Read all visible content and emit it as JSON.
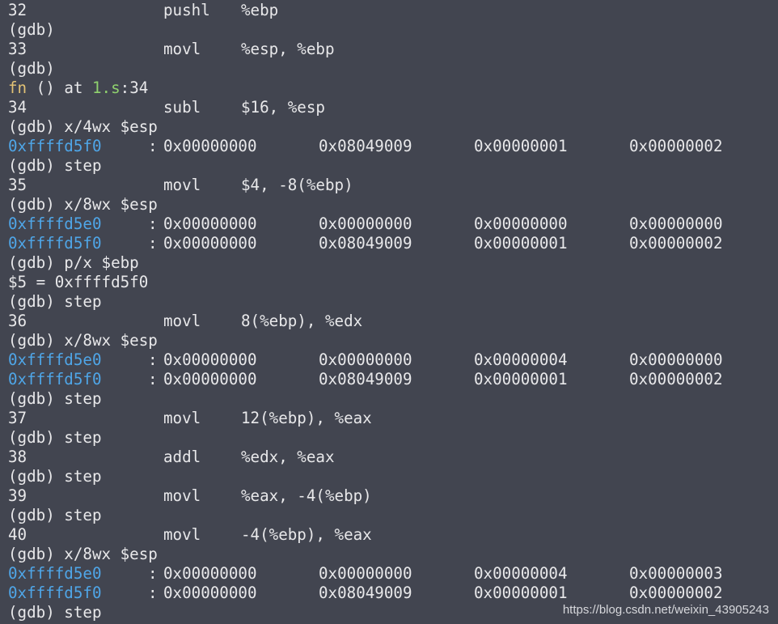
{
  "colors": {
    "background": "#424550",
    "text": "#e8e8ea",
    "address": "#4fa6e8",
    "function_name": "#e2c275",
    "file_name": "#8fd16e"
  },
  "lines": [
    {
      "kind": "src",
      "num": "32",
      "op": "pushl",
      "args": "%ebp"
    },
    {
      "kind": "text",
      "text": "(gdb)"
    },
    {
      "kind": "src",
      "num": "33",
      "op": "movl",
      "args": "%esp, %ebp"
    },
    {
      "kind": "text",
      "text": "(gdb)"
    },
    {
      "kind": "frame",
      "fn": "fn",
      "mid": " () at ",
      "file": "1.s",
      "tail": ":34"
    },
    {
      "kind": "src",
      "num": "34",
      "op": "subl",
      "args": "$16, %esp"
    },
    {
      "kind": "text",
      "text": "(gdb) x/4wx $esp"
    },
    {
      "kind": "mem",
      "addr": "0xffffd5f0",
      "vals": [
        "0x00000000",
        "0x08049009",
        "0x00000001",
        "0x00000002"
      ]
    },
    {
      "kind": "text",
      "text": "(gdb) step"
    },
    {
      "kind": "src",
      "num": "35",
      "op": "movl",
      "args": "$4, -8(%ebp)"
    },
    {
      "kind": "text",
      "text": "(gdb) x/8wx $esp"
    },
    {
      "kind": "mem",
      "addr": "0xffffd5e0",
      "vals": [
        "0x00000000",
        "0x00000000",
        "0x00000000",
        "0x00000000"
      ]
    },
    {
      "kind": "mem",
      "addr": "0xffffd5f0",
      "vals": [
        "0x00000000",
        "0x08049009",
        "0x00000001",
        "0x00000002"
      ]
    },
    {
      "kind": "text",
      "text": "(gdb) p/x $ebp"
    },
    {
      "kind": "text",
      "text": "$5 = 0xffffd5f0"
    },
    {
      "kind": "text",
      "text": "(gdb) step"
    },
    {
      "kind": "src",
      "num": "36",
      "op": "movl",
      "args": "8(%ebp), %edx"
    },
    {
      "kind": "text",
      "text": "(gdb) x/8wx $esp"
    },
    {
      "kind": "mem",
      "addr": "0xffffd5e0",
      "vals": [
        "0x00000000",
        "0x00000000",
        "0x00000004",
        "0x00000000"
      ]
    },
    {
      "kind": "mem",
      "addr": "0xffffd5f0",
      "vals": [
        "0x00000000",
        "0x08049009",
        "0x00000001",
        "0x00000002"
      ]
    },
    {
      "kind": "text",
      "text": "(gdb) step"
    },
    {
      "kind": "src",
      "num": "37",
      "op": "movl",
      "args": "12(%ebp), %eax"
    },
    {
      "kind": "text",
      "text": "(gdb) step"
    },
    {
      "kind": "src",
      "num": "38",
      "op": "addl",
      "args": "%edx, %eax"
    },
    {
      "kind": "text",
      "text": "(gdb) step"
    },
    {
      "kind": "src",
      "num": "39",
      "op": "movl",
      "args": "%eax, -4(%ebp)"
    },
    {
      "kind": "text",
      "text": "(gdb) step"
    },
    {
      "kind": "src",
      "num": "40",
      "op": "movl",
      "args": "-4(%ebp), %eax"
    },
    {
      "kind": "text",
      "text": "(gdb) x/8wx $esp"
    },
    {
      "kind": "mem",
      "addr": "0xffffd5e0",
      "vals": [
        "0x00000000",
        "0x00000000",
        "0x00000004",
        "0x00000003"
      ]
    },
    {
      "kind": "mem",
      "addr": "0xffffd5f0",
      "vals": [
        "0x00000000",
        "0x08049009",
        "0x00000001",
        "0x00000002"
      ]
    },
    {
      "kind": "text",
      "text": "(gdb) step"
    }
  ],
  "watermark": "https://blog.csdn.net/weixin_43905243"
}
